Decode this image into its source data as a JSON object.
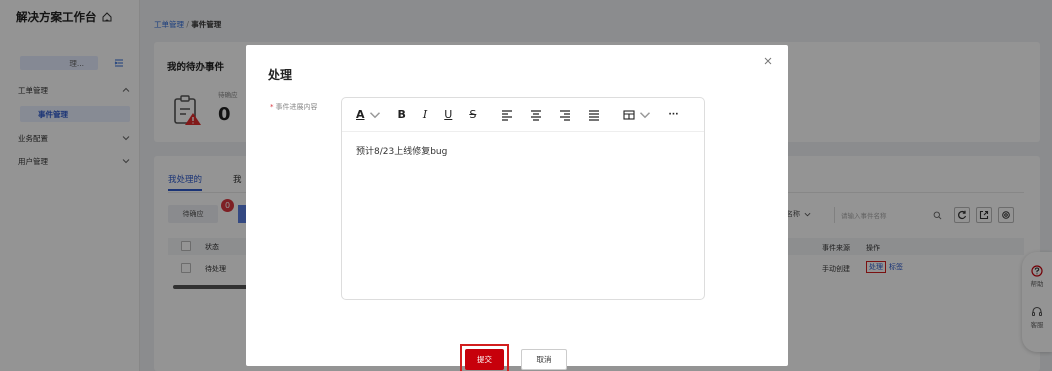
{
  "sidebar": {
    "brand": "解决方案工作台",
    "project_label": "理...",
    "menu": [
      {
        "label": "工单管理"
      },
      {
        "label": "事件管理"
      },
      {
        "label": "业务配置"
      },
      {
        "label": "用户管理"
      }
    ]
  },
  "breadcrumb": {
    "parent": "工单管理",
    "separator": " / ",
    "current": "事件管理"
  },
  "todo": {
    "title": "我的待办事件",
    "stat_label": "待确应",
    "stat_value": "0"
  },
  "list": {
    "tabs": [
      "我处理的",
      "我"
    ],
    "status_pill": "待确应",
    "badge": "0",
    "filter_select": "名称",
    "filter_placeholder": "请输入事件名称",
    "columns": {
      "status": "状态",
      "source": "事件来源",
      "actions": "操作"
    },
    "rows": [
      {
        "status": "待处理",
        "source": "手动创建",
        "action_process": "处理",
        "action_tag": "标签"
      }
    ]
  },
  "help": {
    "help_label": "帮助",
    "service_label": "客服"
  },
  "modal": {
    "title": "处理",
    "field_label": "事件进展内容",
    "required_mark": "*",
    "toolbar": {
      "font_color": "A",
      "bold": "B",
      "italic": "I",
      "underline": "U",
      "strike": "S",
      "more": "···"
    },
    "content": "预计8/23上线修复bug",
    "submit_label": "提交",
    "cancel_label": "取消"
  },
  "colors": {
    "primary_red": "#c7000b",
    "accent_blue": "#2f5bcc",
    "highlight_red": "#d21e1e"
  }
}
